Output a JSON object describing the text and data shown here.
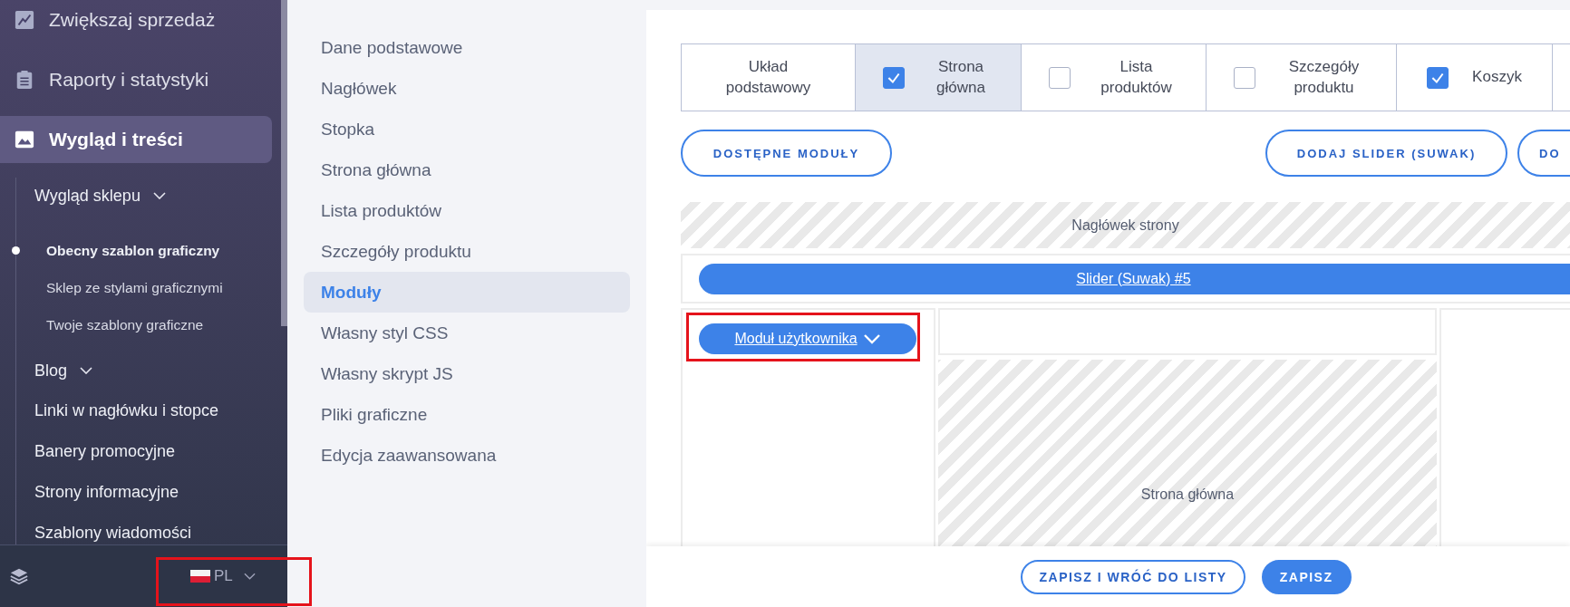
{
  "sidebar": {
    "items": [
      {
        "label": "Zwiększaj sprzedaż",
        "selected": false
      },
      {
        "label": "Raporty i statystyki",
        "selected": false
      },
      {
        "label": "Wygląd i treści",
        "selected": true,
        "children": [
          {
            "label": "Wygląd sklepu",
            "kind": "group",
            "children": [
              {
                "label": "Obecny szablon graficzny",
                "selected": true
              },
              {
                "label": "Sklep ze stylami graficznymi",
                "selected": false
              },
              {
                "label": "Twoje szablony graficzne",
                "selected": false
              }
            ]
          },
          {
            "label": "Blog",
            "kind": "group"
          },
          {
            "label": "Linki w nagłówku i stopce",
            "kind": "link"
          },
          {
            "label": "Banery promocyjne",
            "kind": "link"
          },
          {
            "label": "Strony informacyjne",
            "kind": "link"
          },
          {
            "label": "Szablony wiadomości",
            "kind": "link"
          }
        ]
      }
    ],
    "language": {
      "label": "PL"
    }
  },
  "section_nav": {
    "items": [
      {
        "label": "Dane podstawowe",
        "selected": false
      },
      {
        "label": "Nagłówek",
        "selected": false
      },
      {
        "label": "Stopka",
        "selected": false
      },
      {
        "label": "Strona główna",
        "selected": false
      },
      {
        "label": "Lista produktów",
        "selected": false
      },
      {
        "label": "Szczegóły produktu",
        "selected": false
      },
      {
        "label": "Moduły",
        "selected": true
      },
      {
        "label": "Własny styl CSS",
        "selected": false
      },
      {
        "label": "Własny skrypt JS",
        "selected": false
      },
      {
        "label": "Pliki graficzne",
        "selected": false
      },
      {
        "label": "Edycja zaawansowana",
        "selected": false
      }
    ]
  },
  "layout_tabs": [
    {
      "label": "Układ podstawowy",
      "kind": "plain",
      "selected": false
    },
    {
      "label": "Strona główna",
      "kind": "checkbox",
      "checked": true,
      "selected": true
    },
    {
      "label": "Lista produktów",
      "kind": "checkbox",
      "checked": false,
      "selected": false
    },
    {
      "label": "Szczegóły produktu",
      "kind": "checkbox",
      "checked": false,
      "selected": false
    },
    {
      "label": "Koszyk",
      "kind": "checkbox",
      "checked": true,
      "selected": false
    }
  ],
  "toolbar_buttons": [
    {
      "label": "DOSTĘPNE MODUŁY"
    },
    {
      "label": "DODAJ SLIDER (SUWAK)"
    },
    {
      "label": "DO"
    }
  ],
  "layout": {
    "header_zone": "Nagłówek strony",
    "slider_module": "Slider (Suwak) #5",
    "user_module": "Moduł użytkownika",
    "main_zone": "Strona główna"
  },
  "footer_buttons": [
    {
      "label": "ZAPISZ I WRÓĆ DO LISTY",
      "kind": "outline"
    },
    {
      "label": "ZAPISZ",
      "kind": "primary"
    }
  ]
}
